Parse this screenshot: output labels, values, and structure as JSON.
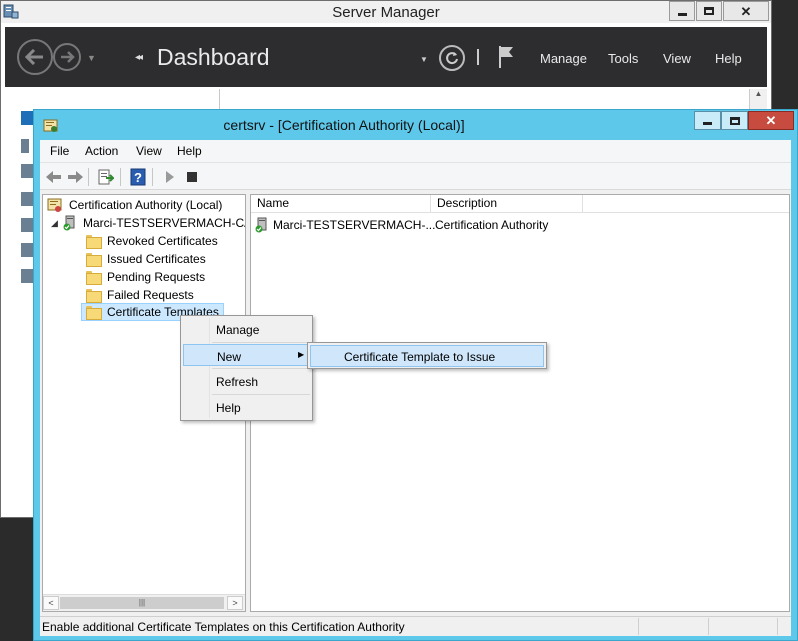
{
  "server_manager": {
    "title": "Server Manager",
    "breadcrumb": "Dashboard",
    "menu": {
      "manage": "Manage",
      "tools": "Tools",
      "view": "View",
      "help": "Help"
    }
  },
  "certsrv": {
    "title": "certsrv - [Certification Authority (Local)]",
    "menubar": {
      "file": "File",
      "action": "Action",
      "view": "View",
      "help": "Help"
    },
    "tree": {
      "root": "Certification Authority (Local)",
      "ca": "Marci-TESTSERVERMACH-CA",
      "folders": [
        "Revoked Certificates",
        "Issued Certificates",
        "Pending Requests",
        "Failed Requests",
        "Certificate Templates"
      ]
    },
    "list": {
      "columns": {
        "name": "Name",
        "description": "Description"
      },
      "rows": [
        {
          "name": "Marci-TESTSERVERMACH-...",
          "description": "Certification Authority"
        }
      ]
    },
    "status": "Enable additional Certificate Templates on this Certification Authority"
  },
  "context_menu": {
    "manage": "Manage",
    "new": "New",
    "refresh": "Refresh",
    "help": "Help"
  },
  "submenu": {
    "item": "Certificate Template to Issue"
  },
  "colors": {
    "active_titlebar": "#5ec8ea",
    "server_manager_header": "#2d2d30",
    "selection": "#cce8ff",
    "menu_highlight": "#cfe6fb",
    "close_button": "#c84b3f"
  }
}
